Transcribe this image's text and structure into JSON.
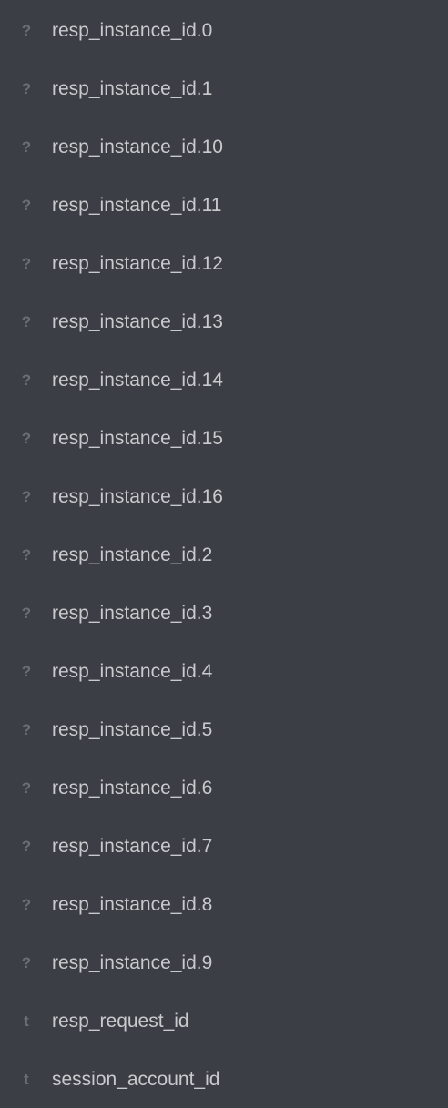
{
  "fields": [
    {
      "type_icon": "?",
      "icon_name": "unknown-type-icon",
      "name": "resp_instance_id.0"
    },
    {
      "type_icon": "?",
      "icon_name": "unknown-type-icon",
      "name": "resp_instance_id.1"
    },
    {
      "type_icon": "?",
      "icon_name": "unknown-type-icon",
      "name": "resp_instance_id.10"
    },
    {
      "type_icon": "?",
      "icon_name": "unknown-type-icon",
      "name": "resp_instance_id.11"
    },
    {
      "type_icon": "?",
      "icon_name": "unknown-type-icon",
      "name": "resp_instance_id.12"
    },
    {
      "type_icon": "?",
      "icon_name": "unknown-type-icon",
      "name": "resp_instance_id.13"
    },
    {
      "type_icon": "?",
      "icon_name": "unknown-type-icon",
      "name": "resp_instance_id.14"
    },
    {
      "type_icon": "?",
      "icon_name": "unknown-type-icon",
      "name": "resp_instance_id.15"
    },
    {
      "type_icon": "?",
      "icon_name": "unknown-type-icon",
      "name": "resp_instance_id.16"
    },
    {
      "type_icon": "?",
      "icon_name": "unknown-type-icon",
      "name": "resp_instance_id.2"
    },
    {
      "type_icon": "?",
      "icon_name": "unknown-type-icon",
      "name": "resp_instance_id.3"
    },
    {
      "type_icon": "?",
      "icon_name": "unknown-type-icon",
      "name": "resp_instance_id.4"
    },
    {
      "type_icon": "?",
      "icon_name": "unknown-type-icon",
      "name": "resp_instance_id.5"
    },
    {
      "type_icon": "?",
      "icon_name": "unknown-type-icon",
      "name": "resp_instance_id.6"
    },
    {
      "type_icon": "?",
      "icon_name": "unknown-type-icon",
      "name": "resp_instance_id.7"
    },
    {
      "type_icon": "?",
      "icon_name": "unknown-type-icon",
      "name": "resp_instance_id.8"
    },
    {
      "type_icon": "?",
      "icon_name": "unknown-type-icon",
      "name": "resp_instance_id.9"
    },
    {
      "type_icon": "t",
      "icon_name": "string-type-icon",
      "name": "resp_request_id"
    },
    {
      "type_icon": "t",
      "icon_name": "string-type-icon",
      "name": "session_account_id"
    }
  ],
  "colors": {
    "background": "#3c3e45",
    "icon": "#6b6e75",
    "text": "#c9cacd"
  }
}
